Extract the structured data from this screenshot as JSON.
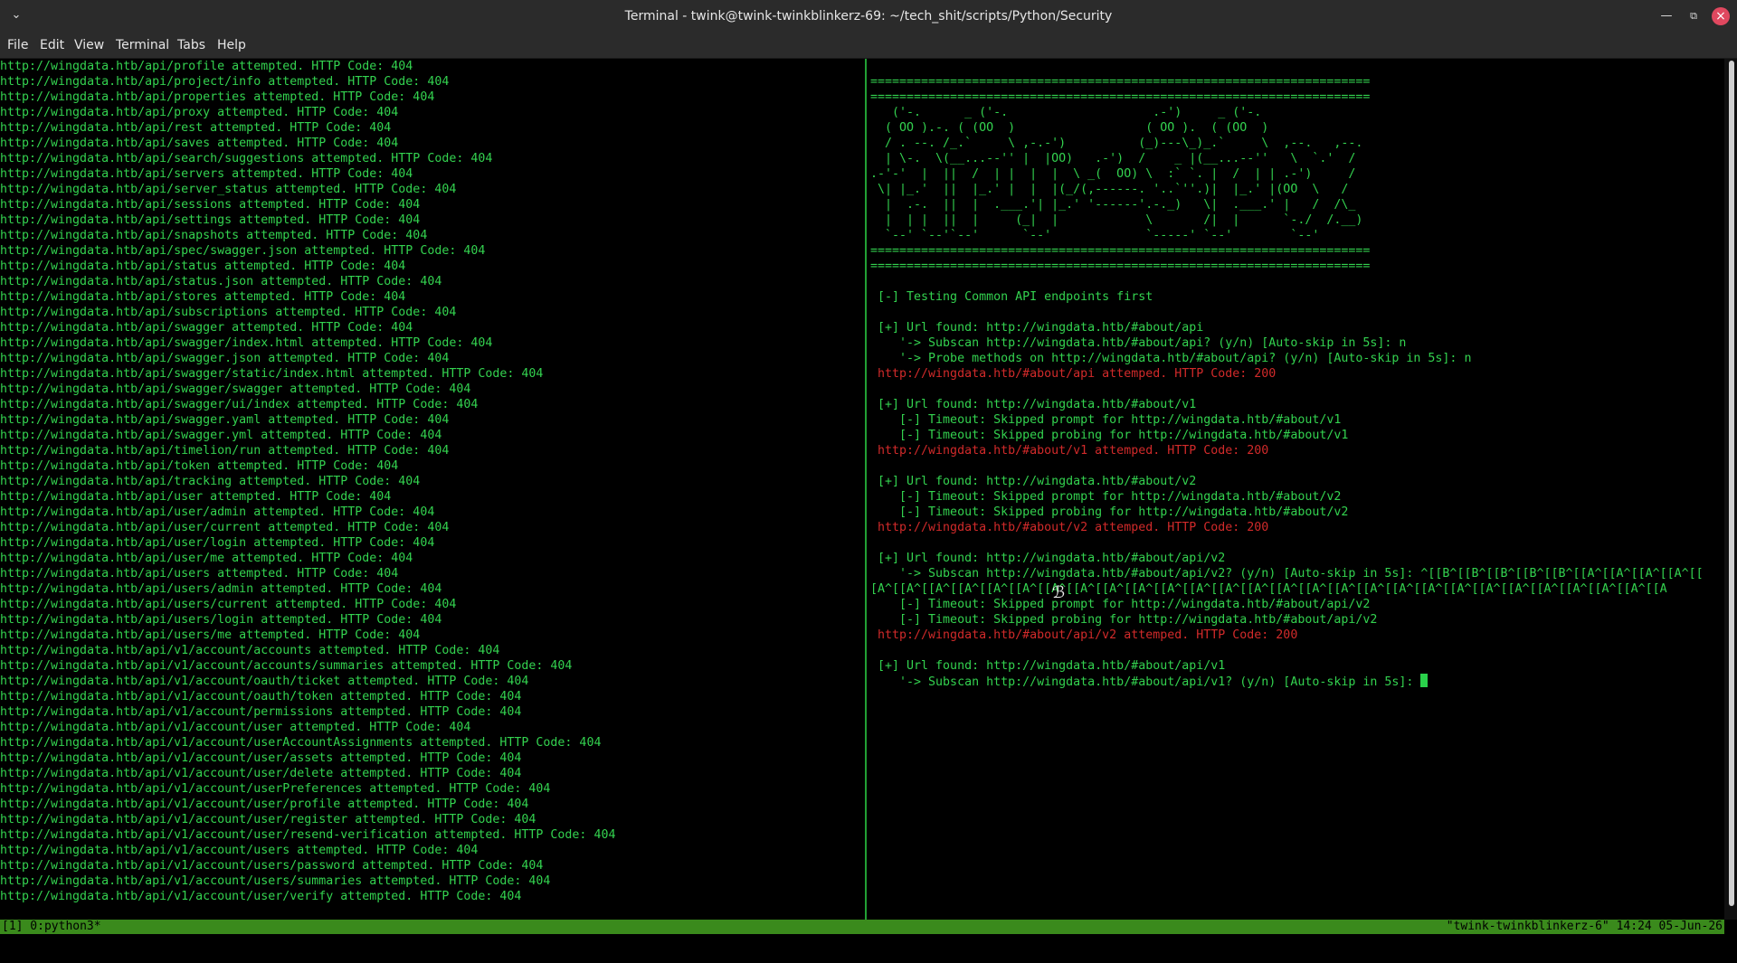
{
  "window": {
    "title": "Terminal - twink@twink-twinkblinkerz-69: ~/tech_shit/scripts/Python/Security"
  },
  "menu": [
    "File",
    "Edit",
    "View",
    "Terminal",
    "Tabs",
    "Help"
  ],
  "left_pane": [
    "http://wingdata.htb/api/profile attempted. HTTP Code: 404",
    "http://wingdata.htb/api/project/info attempted. HTTP Code: 404",
    "http://wingdata.htb/api/properties attempted. HTTP Code: 404",
    "http://wingdata.htb/api/proxy attempted. HTTP Code: 404",
    "http://wingdata.htb/api/rest attempted. HTTP Code: 404",
    "http://wingdata.htb/api/saves attempted. HTTP Code: 404",
    "http://wingdata.htb/api/search/suggestions attempted. HTTP Code: 404",
    "http://wingdata.htb/api/servers attempted. HTTP Code: 404",
    "http://wingdata.htb/api/server_status attempted. HTTP Code: 404",
    "http://wingdata.htb/api/sessions attempted. HTTP Code: 404",
    "http://wingdata.htb/api/settings attempted. HTTP Code: 404",
    "http://wingdata.htb/api/snapshots attempted. HTTP Code: 404",
    "http://wingdata.htb/api/spec/swagger.json attempted. HTTP Code: 404",
    "http://wingdata.htb/api/status attempted. HTTP Code: 404",
    "http://wingdata.htb/api/status.json attempted. HTTP Code: 404",
    "http://wingdata.htb/api/stores attempted. HTTP Code: 404",
    "http://wingdata.htb/api/subscriptions attempted. HTTP Code: 404",
    "http://wingdata.htb/api/swagger attempted. HTTP Code: 404",
    "http://wingdata.htb/api/swagger/index.html attempted. HTTP Code: 404",
    "http://wingdata.htb/api/swagger.json attempted. HTTP Code: 404",
    "http://wingdata.htb/api/swagger/static/index.html attempted. HTTP Code: 404",
    "http://wingdata.htb/api/swagger/swagger attempted. HTTP Code: 404",
    "http://wingdata.htb/api/swagger/ui/index attempted. HTTP Code: 404",
    "http://wingdata.htb/api/swagger.yaml attempted. HTTP Code: 404",
    "http://wingdata.htb/api/swagger.yml attempted. HTTP Code: 404",
    "http://wingdata.htb/api/timelion/run attempted. HTTP Code: 404",
    "http://wingdata.htb/api/token attempted. HTTP Code: 404",
    "http://wingdata.htb/api/tracking attempted. HTTP Code: 404",
    "http://wingdata.htb/api/user attempted. HTTP Code: 404",
    "http://wingdata.htb/api/user/admin attempted. HTTP Code: 404",
    "http://wingdata.htb/api/user/current attempted. HTTP Code: 404",
    "http://wingdata.htb/api/user/login attempted. HTTP Code: 404",
    "http://wingdata.htb/api/user/me attempted. HTTP Code: 404",
    "http://wingdata.htb/api/users attempted. HTTP Code: 404",
    "http://wingdata.htb/api/users/admin attempted. HTTP Code: 404",
    "http://wingdata.htb/api/users/current attempted. HTTP Code: 404",
    "http://wingdata.htb/api/users/login attempted. HTTP Code: 404",
    "http://wingdata.htb/api/users/me attempted. HTTP Code: 404",
    "http://wingdata.htb/api/v1/account/accounts attempted. HTTP Code: 404",
    "http://wingdata.htb/api/v1/account/accounts/summaries attempted. HTTP Code: 404",
    "http://wingdata.htb/api/v1/account/oauth/ticket attempted. HTTP Code: 404",
    "http://wingdata.htb/api/v1/account/oauth/token attempted. HTTP Code: 404",
    "http://wingdata.htb/api/v1/account/permissions attempted. HTTP Code: 404",
    "http://wingdata.htb/api/v1/account/user attempted. HTTP Code: 404",
    "http://wingdata.htb/api/v1/account/userAccountAssignments attempted. HTTP Code: 404",
    "http://wingdata.htb/api/v1/account/user/assets attempted. HTTP Code: 404",
    "http://wingdata.htb/api/v1/account/user/delete attempted. HTTP Code: 404",
    "http://wingdata.htb/api/v1/account/userPreferences attempted. HTTP Code: 404",
    "http://wingdata.htb/api/v1/account/user/profile attempted. HTTP Code: 404",
    "http://wingdata.htb/api/v1/account/user/register attempted. HTTP Code: 404",
    "http://wingdata.htb/api/v1/account/user/resend-verification attempted. HTTP Code: 404",
    "http://wingdata.htb/api/v1/account/users attempted. HTTP Code: 404",
    "http://wingdata.htb/api/v1/account/users/password attempted. HTTP Code: 404",
    "http://wingdata.htb/api/v1/account/users/summaries attempted. HTTP Code: 404",
    "http://wingdata.htb/api/v1/account/user/verify attempted. HTTP Code: 404"
  ],
  "right_pane": [
    {
      "text": "",
      "color": "green"
    },
    {
      "text": "=====================================================================",
      "color": "green"
    },
    {
      "text": "=====================================================================",
      "color": "green"
    },
    {
      "text": "   ('-.      _ ('-.                    .-')     _ ('-.",
      "color": "green"
    },
    {
      "text": "  ( OO ).-. ( (OO  )                  ( OO ).  ( (OO  )",
      "color": "green"
    },
    {
      "text": "  / . --. /_.`     \\ ,-.-')          (_)---\\_)_.`     \\  ,--.   ,--.",
      "color": "green"
    },
    {
      "text": "  | \\-.  \\(__...--'' |  |OO)   .-')  /    _ |(__...--''   \\  `.'  /",
      "color": "green"
    },
    {
      "text": ".-'-'  |  ||  /  | |  |  |  \\ _(  OO) \\  :` `. |  /  | | .-')     /",
      "color": "green"
    },
    {
      "text": " \\| |_.'  ||  |_.' |  |  |(_/(,------. '..`''.)|  |_.' |(OO  \\   /",
      "color": "green"
    },
    {
      "text": "  |  .-.  ||  |  .___.'| |_.' '------'.-._)   \\|  .___.' |   /  /\\_",
      "color": "green"
    },
    {
      "text": "  |  | |  ||  |     (_|  |            \\       /|  |      `-./  /.__)",
      "color": "green"
    },
    {
      "text": "  `--' `--'`--'      `--'             `-----' `--'        `--'",
      "color": "green"
    },
    {
      "text": "=====================================================================",
      "color": "green"
    },
    {
      "text": "=====================================================================",
      "color": "green"
    },
    {
      "text": "",
      "color": "green"
    },
    {
      "text": " [-] Testing Common API endpoints first",
      "color": "green"
    },
    {
      "text": "",
      "color": "green"
    },
    {
      "text": " [+] Url found: http://wingdata.htb/#about/api",
      "color": "green"
    },
    {
      "text": "    '-> Subscan http://wingdata.htb/#about/api? (y/n) [Auto-skip in 5s]: n",
      "color": "green"
    },
    {
      "text": "    '-> Probe methods on http://wingdata.htb/#about/api? (y/n) [Auto-skip in 5s]: n",
      "color": "green"
    },
    {
      "text": " http://wingdata.htb/#about/api attemped. HTTP Code: 200",
      "color": "red"
    },
    {
      "text": "",
      "color": "green"
    },
    {
      "text": " [+] Url found: http://wingdata.htb/#about/v1",
      "color": "green"
    },
    {
      "text": "    [-] Timeout: Skipped prompt for http://wingdata.htb/#about/v1",
      "color": "green"
    },
    {
      "text": "    [-] Timeout: Skipped probing for http://wingdata.htb/#about/v1",
      "color": "green"
    },
    {
      "text": " http://wingdata.htb/#about/v1 attemped. HTTP Code: 200",
      "color": "red"
    },
    {
      "text": "",
      "color": "green"
    },
    {
      "text": " [+] Url found: http://wingdata.htb/#about/v2",
      "color": "green"
    },
    {
      "text": "    [-] Timeout: Skipped prompt for http://wingdata.htb/#about/v2",
      "color": "green"
    },
    {
      "text": "    [-] Timeout: Skipped probing for http://wingdata.htb/#about/v2",
      "color": "green"
    },
    {
      "text": " http://wingdata.htb/#about/v2 attemped. HTTP Code: 200",
      "color": "red"
    },
    {
      "text": "",
      "color": "green"
    },
    {
      "text": " [+] Url found: http://wingdata.htb/#about/api/v2",
      "color": "green"
    },
    {
      "text": "    '-> Subscan http://wingdata.htb/#about/api/v2? (y/n) [Auto-skip in 5s]: ^[[B^[[B^[[B^[[B^[[B^[[A^[[A^[[A^[[A^[[",
      "color": "green"
    },
    {
      "text": "[A^[[A^[[A^[[A^[[A^[[A^[[A^[[A^[[A^[[A^[[A^[[A^[[A^[[A^[[A^[[A^[[A^[[A^[[A^[[A^[[A^[[A^[[A^[[A^[[A^[[A^[[A^[[A",
      "color": "green"
    },
    {
      "text": "    [-] Timeout: Skipped prompt for http://wingdata.htb/#about/api/v2",
      "color": "green"
    },
    {
      "text": "    [-] Timeout: Skipped probing for http://wingdata.htb/#about/api/v2",
      "color": "green"
    },
    {
      "text": " http://wingdata.htb/#about/api/v2 attemped. HTTP Code: 200",
      "color": "red"
    },
    {
      "text": "",
      "color": "green"
    },
    {
      "text": " [+] Url found: http://wingdata.htb/#about/api/v1",
      "color": "green"
    },
    {
      "text": "    '-> Subscan http://wingdata.htb/#about/api/v1? (y/n) [Auto-skip in 5s]: ",
      "color": "green",
      "cursor": true
    }
  ],
  "status": {
    "left": "[1] 0:python3*",
    "right": "\"twink-twinkblinkerz-6\" 14:24 05-Jun-26"
  },
  "colors": {
    "green": "#33d24f",
    "red": "#d12a2a",
    "status_bg": "#3a8a1c"
  }
}
